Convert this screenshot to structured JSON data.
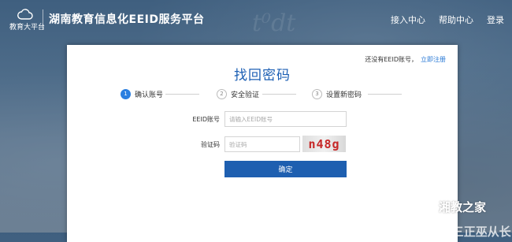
{
  "header": {
    "logo_text": "教育大平台",
    "site_title": "湖南教育信息化EEID服务平台",
    "nav": [
      "接入中心",
      "帮助中心",
      "登录"
    ]
  },
  "background": {
    "chalk_text": "t⁰dt"
  },
  "card": {
    "register_prompt": "还没有EEID账号，",
    "register_link": "立即注册",
    "title": "找回密码",
    "steps": [
      {
        "num": "1",
        "label": "确认账号",
        "active": true
      },
      {
        "num": "2",
        "label": "安全验证",
        "active": false
      },
      {
        "num": "3",
        "label": "设置新密码",
        "active": false
      }
    ],
    "form": {
      "eeid_label": "EEID账号",
      "eeid_placeholder": "请输入EEID账号",
      "captcha_label": "验证码",
      "captcha_placeholder": "验证码",
      "captcha_value": "n48g",
      "confirm_label": "确定"
    }
  },
  "watermark": {
    "text": "湘教之家",
    "partial_text": "/ 〈〈 ‹‹〈 ⌐ 事三正巫从长 |"
  },
  "colors": {
    "accent": "#1e5fb0",
    "title": "#1c5fb4",
    "step_active": "#2b7fe0",
    "captcha_text": "#c62828"
  }
}
